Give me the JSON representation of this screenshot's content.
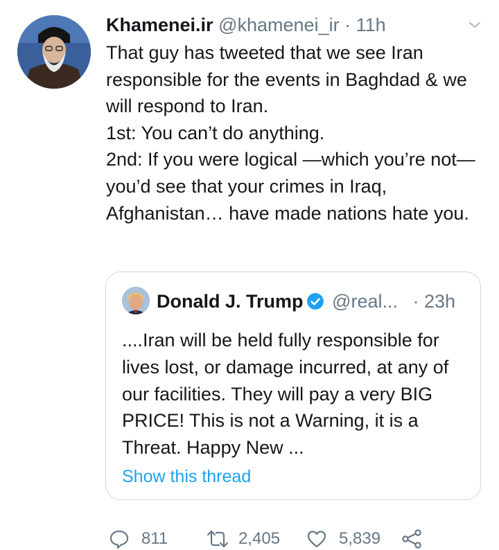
{
  "tweet": {
    "author_name": "Khamenei.ir",
    "handle": "@khamenei_ir",
    "separator": "·",
    "time": "11h",
    "text": "That guy has tweeted that we see Iran responsible for the events in Baghdad & we will respond to Iran.\n1st: You can’t do anything.\n2nd: If you were logical —which you’re not— you’d see that your crimes in Iraq, Afghanistan… have made nations hate you."
  },
  "quoted": {
    "author_name": "Donald J. Trump",
    "handle": "@real...",
    "separator": "·",
    "time": "23h",
    "text": "....Iran will be held fully responsible for lives lost, or damage incurred, at any of our facilities. They will pay a very BIG PRICE! This is not a Warning, it is a Threat. Happy New ...",
    "thread_link": "Show this thread"
  },
  "actions": {
    "replies": "811",
    "retweets": "2,405",
    "likes": "5,839"
  },
  "colors": {
    "accent": "#1da1f2",
    "secondary_text": "#657786",
    "border": "#ccd6dd"
  },
  "icons": [
    "chevron-down-icon",
    "verified-badge-icon",
    "reply-icon",
    "retweet-icon",
    "like-icon",
    "share-icon"
  ]
}
